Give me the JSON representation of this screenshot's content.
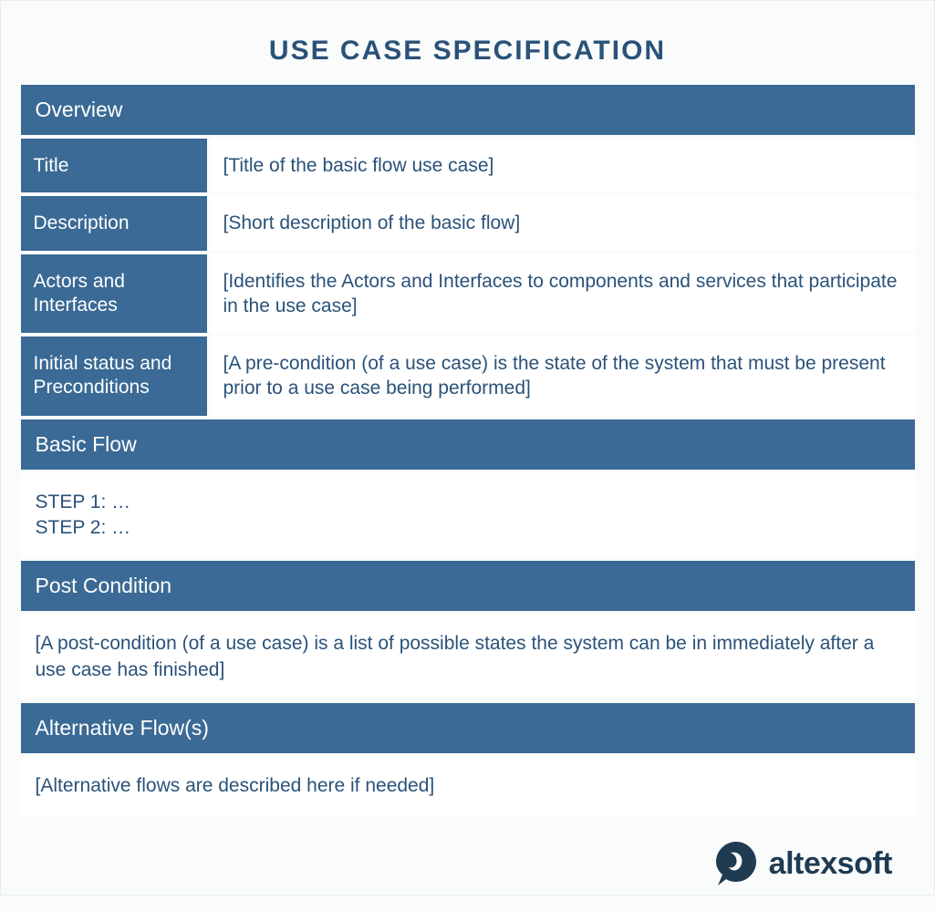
{
  "title": "USE CASE SPECIFICATION",
  "sections": {
    "overview": {
      "header": "Overview",
      "rows": [
        {
          "label": "Title",
          "value": "[Title of the basic flow use case]"
        },
        {
          "label": "Description",
          "value": "[Short description of the basic flow]"
        },
        {
          "label": "Actors and Interfaces",
          "value": "[Identifies the Actors and Interfaces to components and services that participate in the use case]"
        },
        {
          "label": "Initial status and Preconditions",
          "value": "[A pre-condition (of a use case) is the state of the system that must be present prior to a use case being performed]"
        }
      ]
    },
    "basic_flow": {
      "header": "Basic Flow",
      "content": "STEP 1: …\nSTEP 2: …"
    },
    "post_condition": {
      "header": "Post Condition",
      "content": "[A post-condition (of a use case) is a list of possible states the system can be in immediately after a use case has finished]"
    },
    "alternative_flows": {
      "header": "Alternative Flow(s)",
      "content": "[Alternative flows are described here if needed]"
    }
  },
  "logo": {
    "text": "altexsoft"
  }
}
